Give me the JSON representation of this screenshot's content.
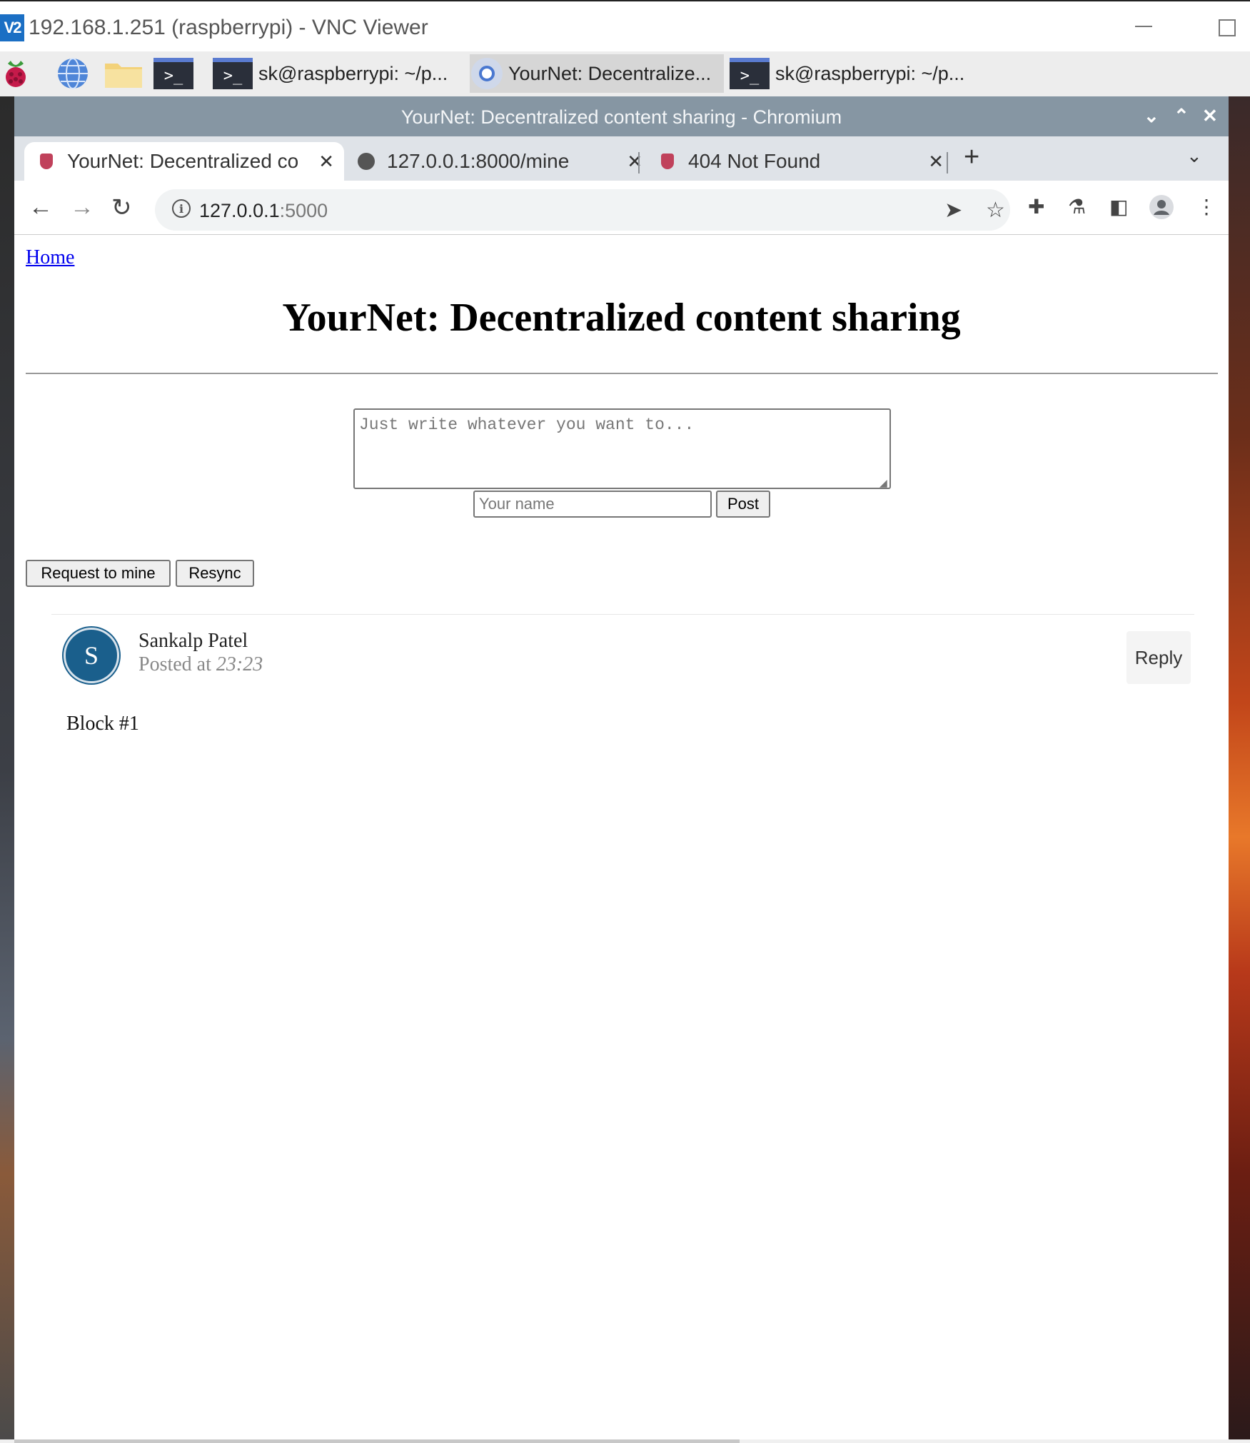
{
  "vnc": {
    "logo": "V2",
    "title": "192.168.1.251 (raspberrypi) - VNC Viewer"
  },
  "taskbar": {
    "icons": [
      "raspberry-icon",
      "globe-icon",
      "folder-icon",
      "terminal-icon"
    ],
    "terminal_glyph": ">_",
    "tasks": [
      {
        "label": "sk@raspberrypi: ~/p...",
        "icon": "terminal-icon",
        "active": false
      },
      {
        "label": "YourNet: Decentralize...",
        "icon": "chromium-icon",
        "active": true
      },
      {
        "label": "sk@raspberrypi: ~/p...",
        "icon": "terminal-icon",
        "active": false
      }
    ]
  },
  "browser": {
    "window_title": "YourNet: Decentralized content sharing - Chromium",
    "tabs": [
      {
        "label": "YourNet: Decentralized co",
        "favicon": "yournet-favicon",
        "active": true
      },
      {
        "label": "127.0.0.1:8000/mine",
        "favicon": "globe-icon",
        "active": false
      },
      {
        "label": "404 Not Found",
        "favicon": "yournet-favicon",
        "active": false
      }
    ],
    "url_host": "127.0.0.1",
    "url_port": ":5000"
  },
  "page": {
    "home_link": "Home",
    "title": "YourNet: Decentralized content sharing",
    "textarea_placeholder": "Just write whatever you want to...",
    "name_placeholder": "Your name",
    "post_button": "Post",
    "request_mine_button": "Request to mine",
    "resync_button": "Resync",
    "posts": [
      {
        "avatar_letter": "S",
        "author": "Sankalp Patel",
        "posted_prefix": "Posted at",
        "time": "23:23",
        "reply_label": "Reply",
        "content": "Block #1"
      }
    ]
  },
  "colors": {
    "chrome_titlebar": "#8696a3",
    "avatar": "#1a5f8c",
    "link": "#0000ee"
  }
}
